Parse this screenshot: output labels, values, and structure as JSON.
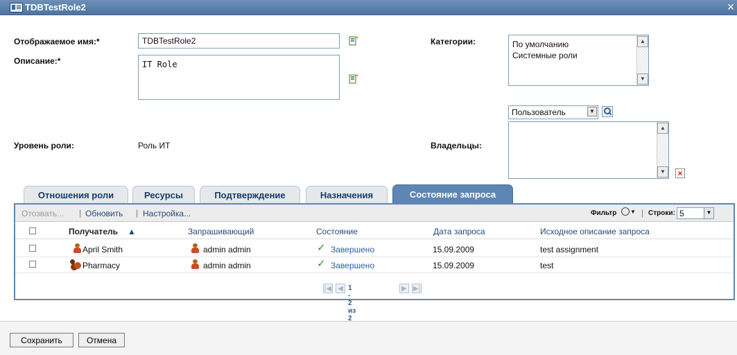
{
  "window": {
    "title": "TDBTestRole2"
  },
  "form": {
    "display_name_label": "Отображаемое имя:*",
    "display_name_value": "TDBTestRole2",
    "description_label": "Описание:*",
    "description_value": "IT Role",
    "categories_label": "Категории:",
    "categories": [
      "По умолчанию",
      "Системные роли"
    ],
    "role_level_label": "Уровень роли:",
    "role_level_value": "Роль ИТ",
    "owners_label": "Владельцы:",
    "owner_type_selected": "Пользователь"
  },
  "tabs": [
    {
      "label": "Отношения роли",
      "active": false
    },
    {
      "label": "Ресурсы",
      "active": false
    },
    {
      "label": "Подтверждение",
      "active": false
    },
    {
      "label": "Назначения",
      "active": false
    },
    {
      "label": "Состояние запроса",
      "active": true
    }
  ],
  "toolbar": {
    "revoke_label": "Отозвать...",
    "refresh_label": "Обновить",
    "settings_label": "Настройка...",
    "filter_label": "Фильтр",
    "rows_label": "Строки:",
    "rows_value": "5"
  },
  "table": {
    "columns": [
      "Получатель",
      "Запрашивающий",
      "Состояние",
      "Дата запроса",
      "Исходное описание запроса"
    ],
    "sort_indicator": "▲",
    "rows": [
      {
        "recipient": "April Smith",
        "recipient_type": "user",
        "requester": "admin admin",
        "status": "Завершено",
        "date": "15.09.2009",
        "description": "test assignment"
      },
      {
        "recipient": "Pharmacy",
        "recipient_type": "group",
        "requester": "admin admin",
        "status": "Завершено",
        "date": "15.09.2009",
        "description": "test"
      }
    ],
    "pager_text": "1 - 2 из 2"
  },
  "buttons": {
    "save_label": "Сохранить",
    "cancel_label": "Отмена"
  }
}
